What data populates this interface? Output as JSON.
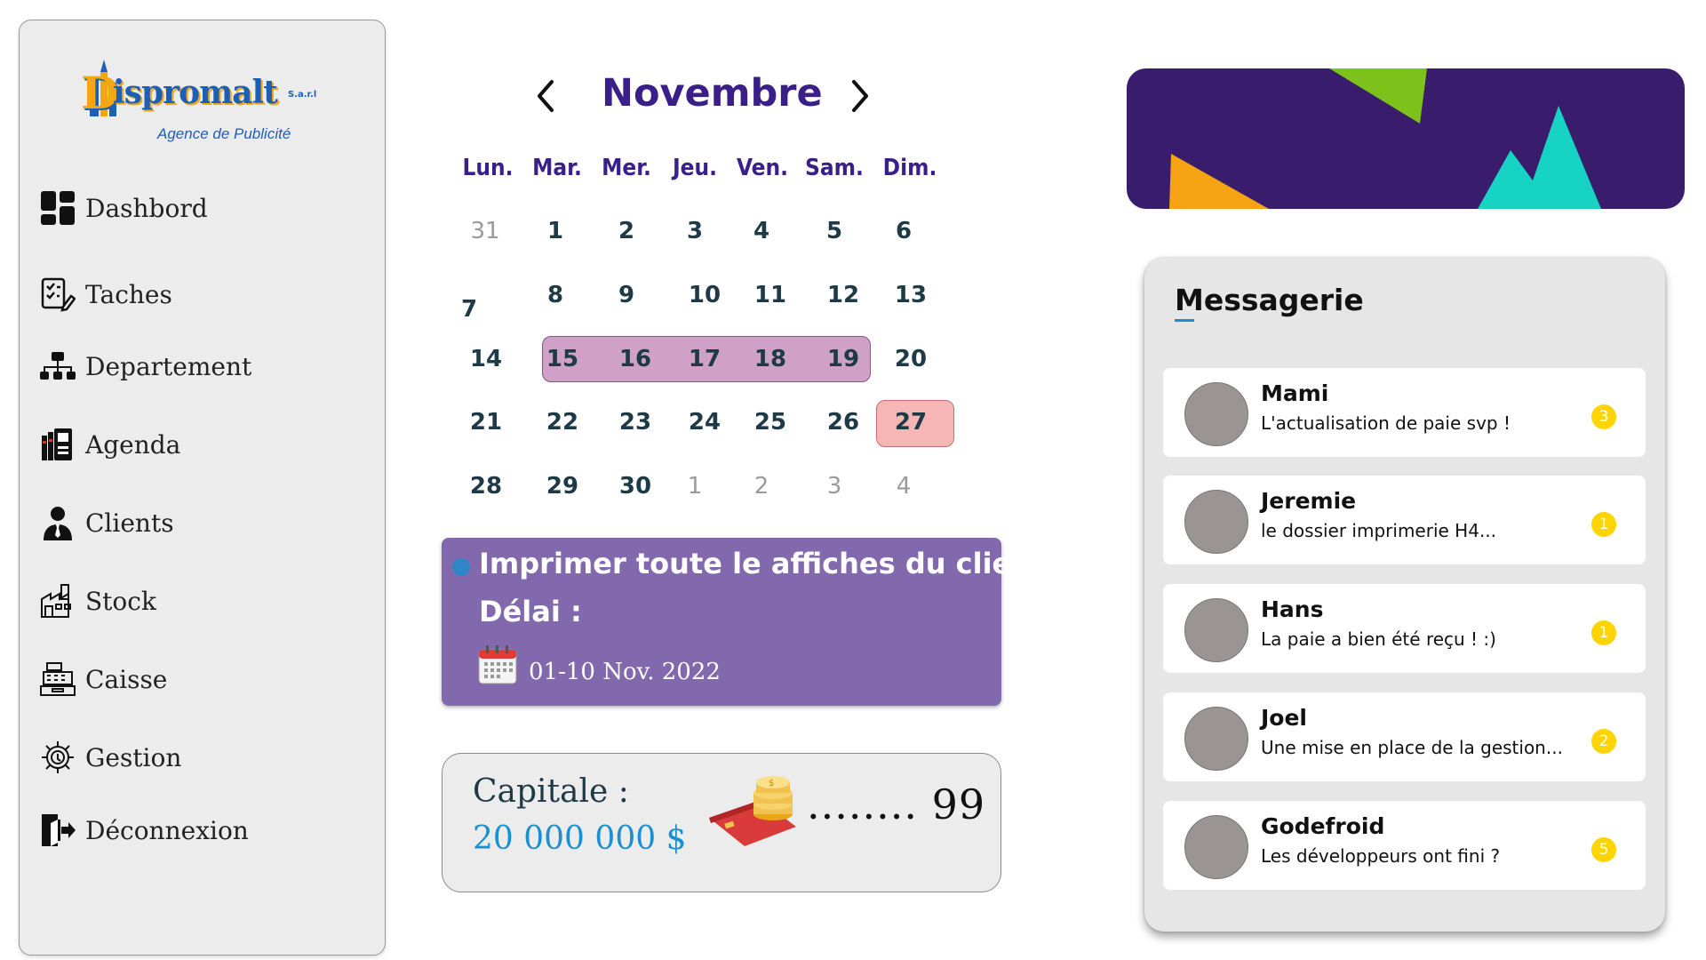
{
  "sidebar": {
    "logo": {
      "letter": "D",
      "brand": "ispromalt",
      "sarl": "S.a.r.l",
      "tagline": "Agence de Publicité"
    },
    "items": [
      {
        "label": "Dashbord",
        "icon": "dashboard-icon"
      },
      {
        "label": "Taches",
        "icon": "tasks-icon"
      },
      {
        "label": "Departement",
        "icon": "org-chart-icon"
      },
      {
        "label": "Agenda",
        "icon": "agenda-icon"
      },
      {
        "label": "Clients",
        "icon": "user-icon"
      },
      {
        "label": "Stock",
        "icon": "warehouse-icon"
      },
      {
        "label": "Caisse",
        "icon": "cash-register-icon"
      },
      {
        "label": "Gestion",
        "icon": "gear-icon"
      },
      {
        "label": "Déconnexion",
        "icon": "logout-icon"
      }
    ]
  },
  "calendar": {
    "month": "Novembre",
    "weekdays": [
      "Lun.",
      "Mar.",
      "Mer.",
      "Jeu.",
      "Ven.",
      "Sam.",
      "Dim."
    ],
    "rows": [
      [
        "31",
        "1",
        "2",
        "3",
        "4",
        "5",
        "6"
      ],
      [
        "7",
        "8",
        "9",
        "10",
        "11",
        "12",
        "13"
      ],
      [
        "14",
        "15",
        "16",
        "17",
        "18",
        "19",
        "20"
      ],
      [
        "21",
        "22",
        "23",
        "24",
        "25",
        "26",
        "27"
      ],
      [
        "28",
        "29",
        "30",
        "1",
        "2",
        "3",
        "4"
      ]
    ],
    "highlight_range": [
      "15",
      "16",
      "17",
      "18",
      "19"
    ],
    "today": "27",
    "colors": {
      "month": "#3b1f88",
      "range": "#cfa0c8",
      "today": "#f6b6b6"
    }
  },
  "task": {
    "title": "Imprimer toute le affiches du client",
    "delay_label": "Délai :",
    "dates": "01-10 Nov. 2022",
    "color": "#8269ad"
  },
  "capital": {
    "label": "Capitale :",
    "amount": "20 000 000 $",
    "count": "........ 99"
  },
  "banner": {
    "background": "#3a1c6c",
    "shapes": [
      "#7cc21b",
      "#f5a313",
      "#16d3c3"
    ]
  },
  "messagerie": {
    "title": "Messagerie",
    "messages": [
      {
        "name": "Mami",
        "text": "L'actualisation de paie svp !",
        "badge": "3"
      },
      {
        "name": "Jeremie",
        "text": "le dossier imprimerie H4...",
        "badge": "1"
      },
      {
        "name": "Hans",
        "text": "La paie a bien été reçu ! :)",
        "badge": "1"
      },
      {
        "name": "Joel",
        "text": "Une mise en place de la gestion...",
        "badge": "2"
      },
      {
        "name": "Godefroid",
        "text": "Les développeurs ont fini ?",
        "badge": "5"
      }
    ]
  }
}
